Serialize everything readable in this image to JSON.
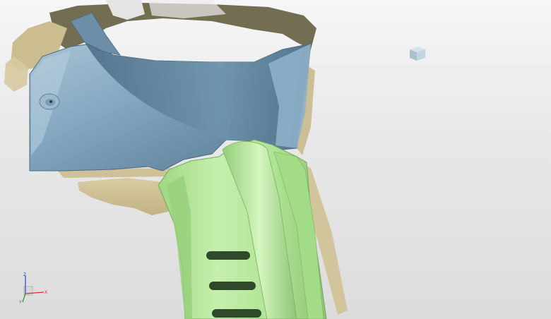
{
  "viewport": {
    "background_top": "#f6f6f6",
    "background_bottom": "#dcdcdc"
  },
  "model": {
    "shell_color": "#7fa3bd",
    "shell_highlight": "#a8c4d6",
    "shell_shadow": "#4f7089",
    "grip_color": "#b4e59a",
    "grip_highlight": "#d3f4bd",
    "grip_shadow": "#86bb6c",
    "scan_color": "#c9b98e",
    "scan_dark_color": "#5e5a42",
    "slot_color": "#2f4a2a"
  },
  "view_cube": {
    "icon": "cube-icon",
    "color": "#b8cfd9"
  },
  "triad": {
    "icon": "coordinate-triad-icon",
    "x_label": "X",
    "y_label": "Y",
    "z_label": "Z",
    "x_color": "#d9302c",
    "y_color": "#2f8f2f",
    "z_color": "#2b47c9"
  }
}
